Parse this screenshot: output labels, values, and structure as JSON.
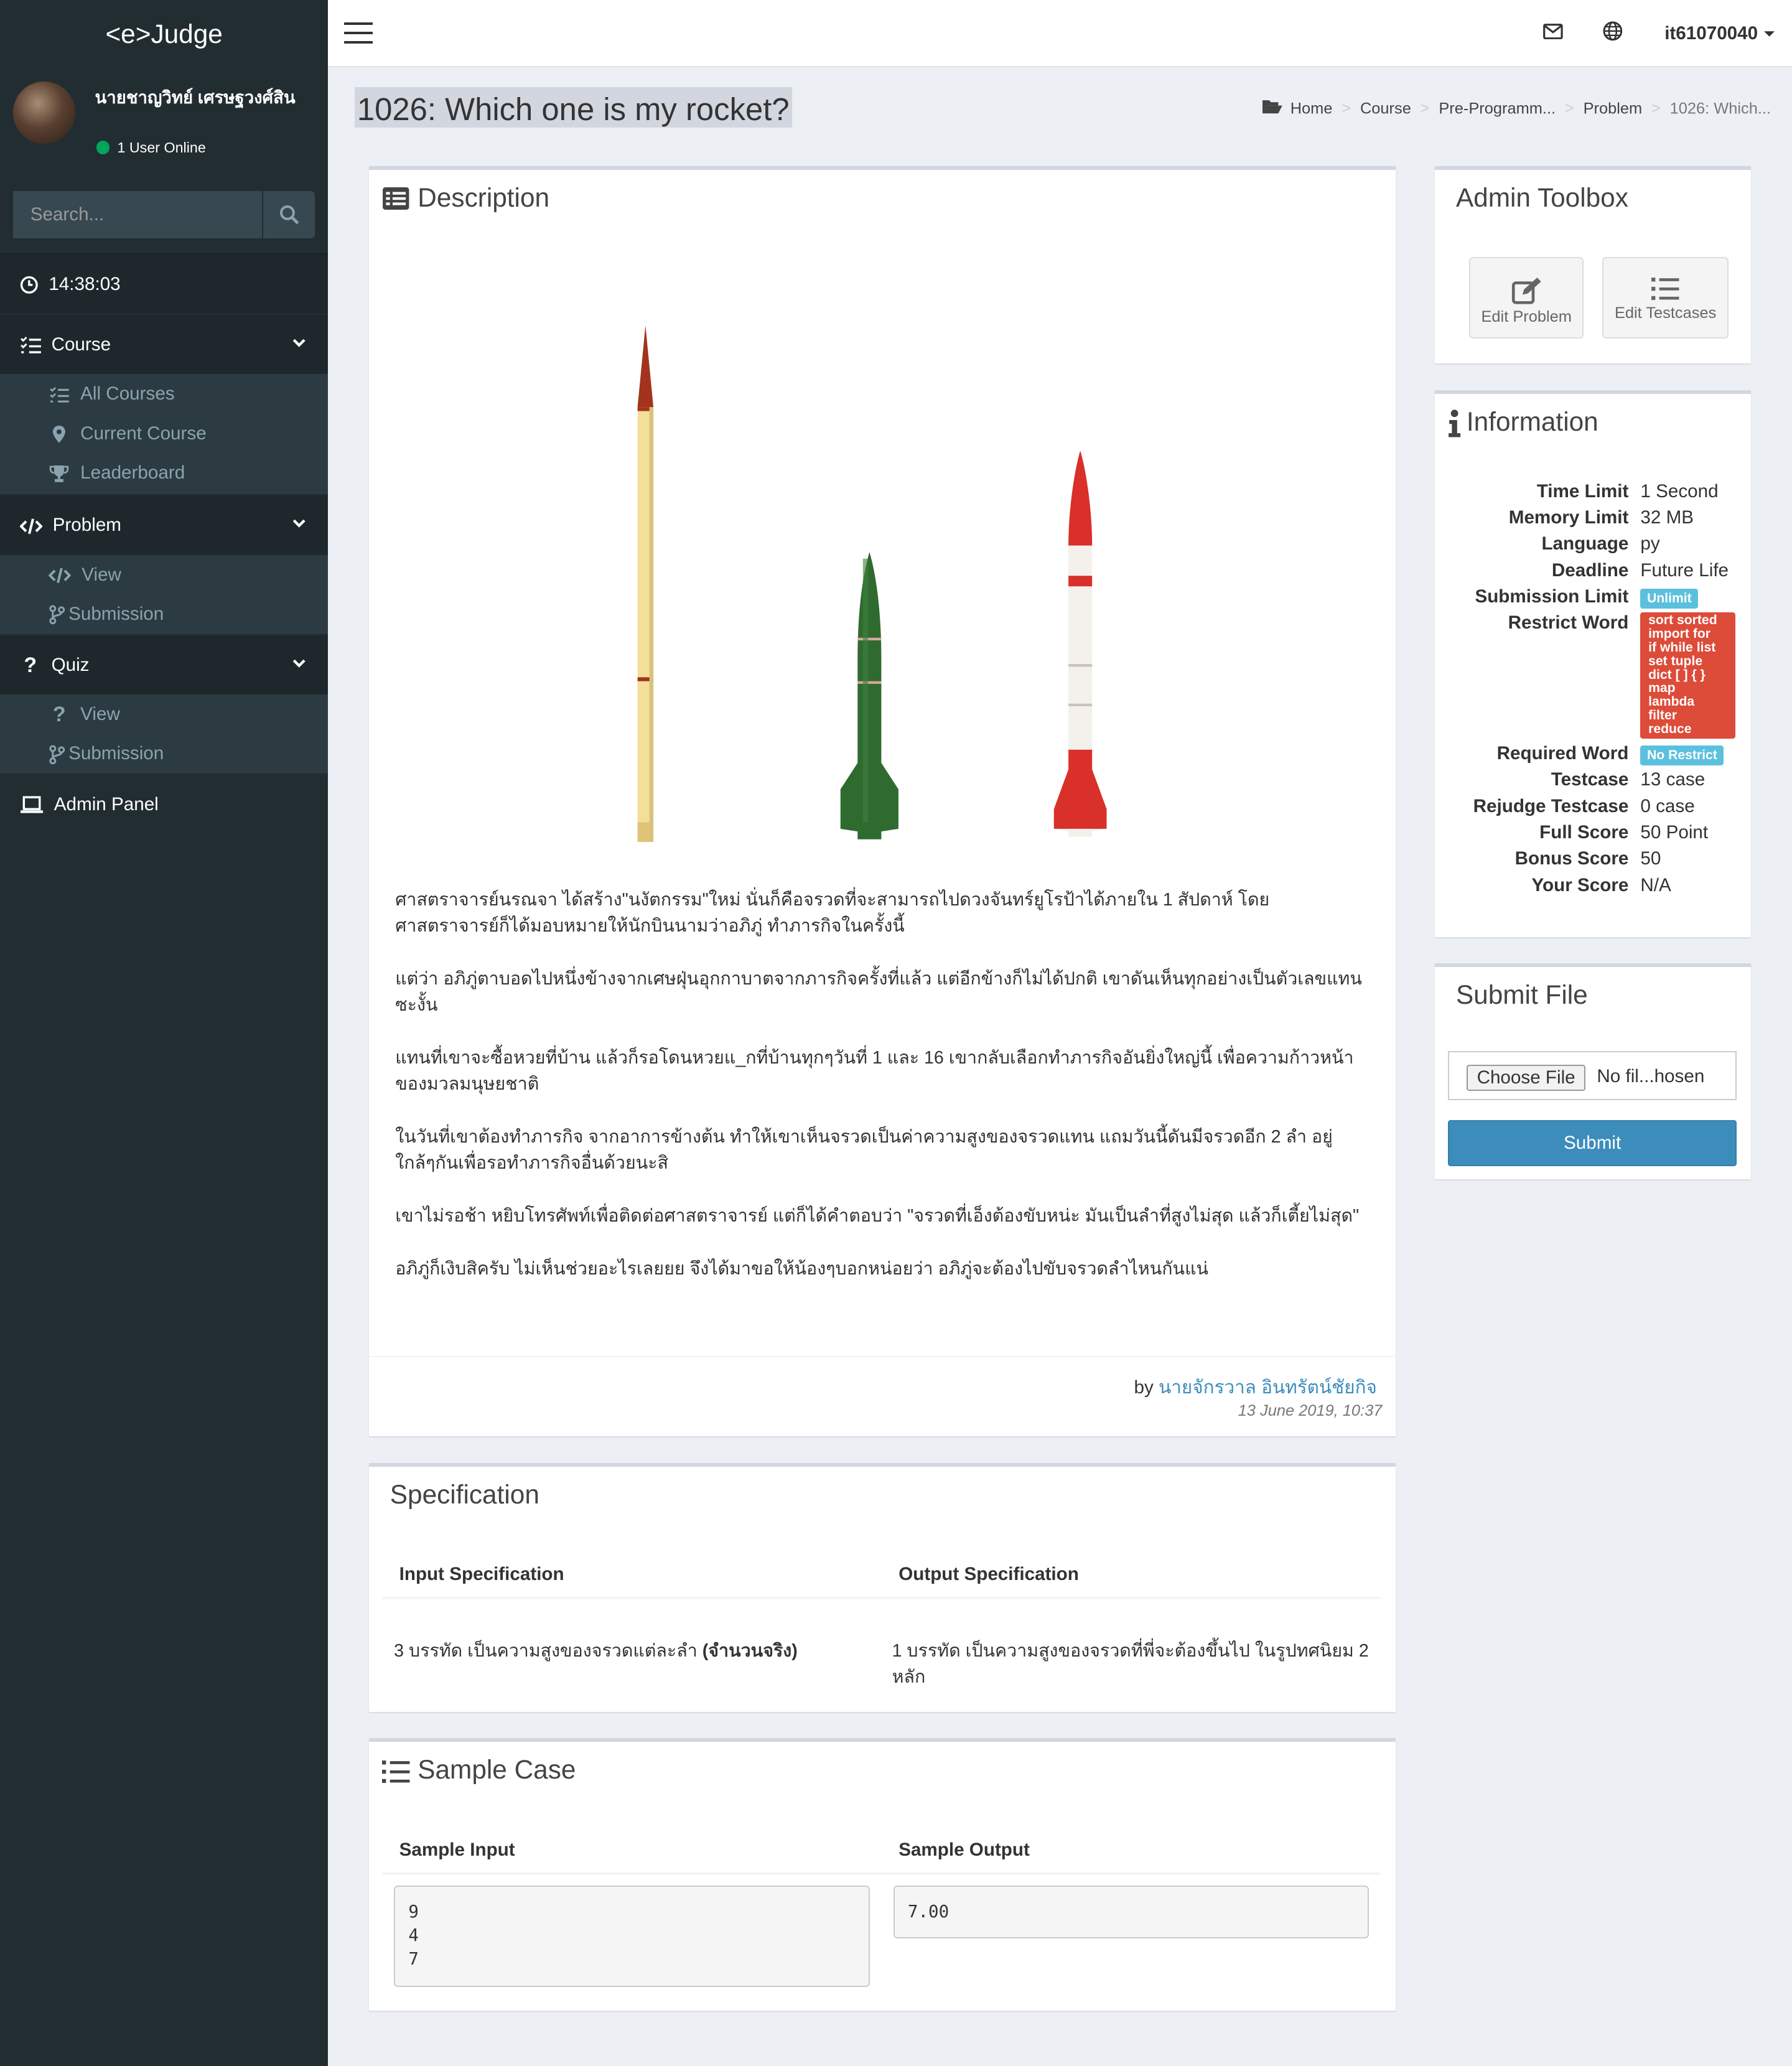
{
  "brand": "<e>Judge",
  "user": {
    "name": "นายชาญวิทย์ เศรษฐวงศ์สิน",
    "status": "1 User Online"
  },
  "search": {
    "placeholder": "Search..."
  },
  "clock": "14:38:03",
  "menu": {
    "course": {
      "label": "Course",
      "items": [
        "All Courses",
        "Current Course",
        "Leaderboard"
      ]
    },
    "problem": {
      "label": "Problem",
      "items": [
        "View",
        "Submission"
      ]
    },
    "quiz": {
      "label": "Quiz",
      "items": [
        "View",
        "Submission"
      ]
    },
    "admin": "Admin Panel"
  },
  "topbar": {
    "username": "it61070040"
  },
  "page": {
    "title": "1026: Which one is my rocket?"
  },
  "breadcrumb": [
    "Home",
    "Course",
    "Pre-Programm...",
    "Problem",
    "1026: Which..."
  ],
  "description": {
    "heading": "Description",
    "paragraphs": [
      "ศาสตราจารย์นรณจา ได้สร้าง\"นงัตกรรม\"ใหม่ นั่นก็คือจรวดที่จะสามารถไปดวงจันทร์ยูโรป้าได้ภายใน 1 สัปดาห์ โดยศาสตราจารย์ก็ได้มอบหมายให้นักบินนามว่าอภิภู่ ทำภารกิจในครั้งนี้",
      "แต่ว่า อภิภู่ตาบอดไปหนึ่งข้างจากเศษฝุ่นอุกกาบาตจากภารกิจครั้งที่แล้ว แต่อีกข้างก็ไม่ได้ปกติ เขาดันเห็นทุกอย่างเป็นตัวเลขแทนซะงั้น",
      "แทนที่เขาจะซื้อหวยที่บ้าน แล้วก็รอโดนหวยแ_กที่บ้านทุกๆวันที่ 1 และ 16 เขากลับเลือกทำภารกิจอันยิ่งใหญ่นี้ เพื่อความก้าวหน้าของมวลมนุษยชาติ",
      "ในวันที่เขาต้องทำภารกิจ จากอาการข้างต้น ทำให้เขาเห็นจรวดเป็นค่าความสูงของจรวดแทน แถมวันนี้ดันมีจรวดอีก 2 ลำ อยู่ใกล้ๆกันเพื่อรอทำภารกิจอื่นด้วยนะสิ",
      "เขาไม่รอช้า หยิบโทรศัพท์เพื่อติดต่อศาสตราจารย์ แต่ก็ได้คำตอบว่า \"จรวดที่เอ็งต้องขับหน่ะ มันเป็นลำที่สูงไม่สุด แล้วก็เตี้ยไม่สุด\"",
      "อภิภู่ก็เงิบสิครับ ไม่เห็นช่วยอะไรเลยยย จึงได้มาขอให้น้องๆบอกหน่อยว่า อภิภู่จะต้องไปขับจรวดลำไหนกันแน่"
    ],
    "by_label": "by",
    "author": "นายจักรวาล อินทรัตน์ชัยกิจ",
    "date": "13 June 2019, 10:37"
  },
  "toolbox": {
    "title": "Admin Toolbox",
    "edit_problem": "Edit Problem",
    "edit_testcases": "Edit Testcases"
  },
  "info": {
    "title": "Information",
    "rows": [
      {
        "k": "Time Limit",
        "v": "1 Second"
      },
      {
        "k": "Memory Limit",
        "v": "32 MB"
      },
      {
        "k": "Language",
        "v": "py"
      },
      {
        "k": "Deadline",
        "v": "Future Life"
      },
      {
        "k": "Submission Limit",
        "v": "Unlimit"
      },
      {
        "k": "Restrict Word",
        "v": "sort sorted import for if while list set tuple dict [ ] { } map lambda filter reduce"
      },
      {
        "k": "Required Word",
        "v": "No Restrict"
      },
      {
        "k": "Testcase",
        "v": "13 case"
      },
      {
        "k": "Rejudge Testcase",
        "v": "0 case"
      },
      {
        "k": "Full Score",
        "v": "50 Point"
      },
      {
        "k": "Bonus Score",
        "v": "50"
      },
      {
        "k": "Your Score",
        "v": "N/A"
      }
    ],
    "restrict_lines": [
      "sort sorted",
      "import for",
      "if while list",
      "set tuple",
      "dict [ ] { }",
      "map",
      "lambda",
      "filter",
      "reduce"
    ]
  },
  "submit": {
    "title": "Submit File",
    "choose": "Choose File",
    "nofile": "No fil...hosen",
    "button": "Submit"
  },
  "spec": {
    "title": "Specification",
    "input_h": "Input Specification",
    "output_h": "Output Specification",
    "input_text": "3 บรรทัด เป็นความสูงของจรวดแต่ละลำ ",
    "input_bold": "(จำนวนจริง)",
    "output_text": "1 บรรทัด เป็นความสูงของจรวดที่พี่จะต้องขึ้นไป ในรูปทศนิยม 2 หลัก"
  },
  "sample": {
    "title": "Sample Case",
    "input_h": "Sample Input",
    "output_h": "Sample Output",
    "input": "9\n4\n7",
    "output": "7.00"
  },
  "colors": {
    "sidebar": "#222d32",
    "accent": "#3c8dbc",
    "danger": "#dd4b39",
    "info": "#5bc0de"
  }
}
